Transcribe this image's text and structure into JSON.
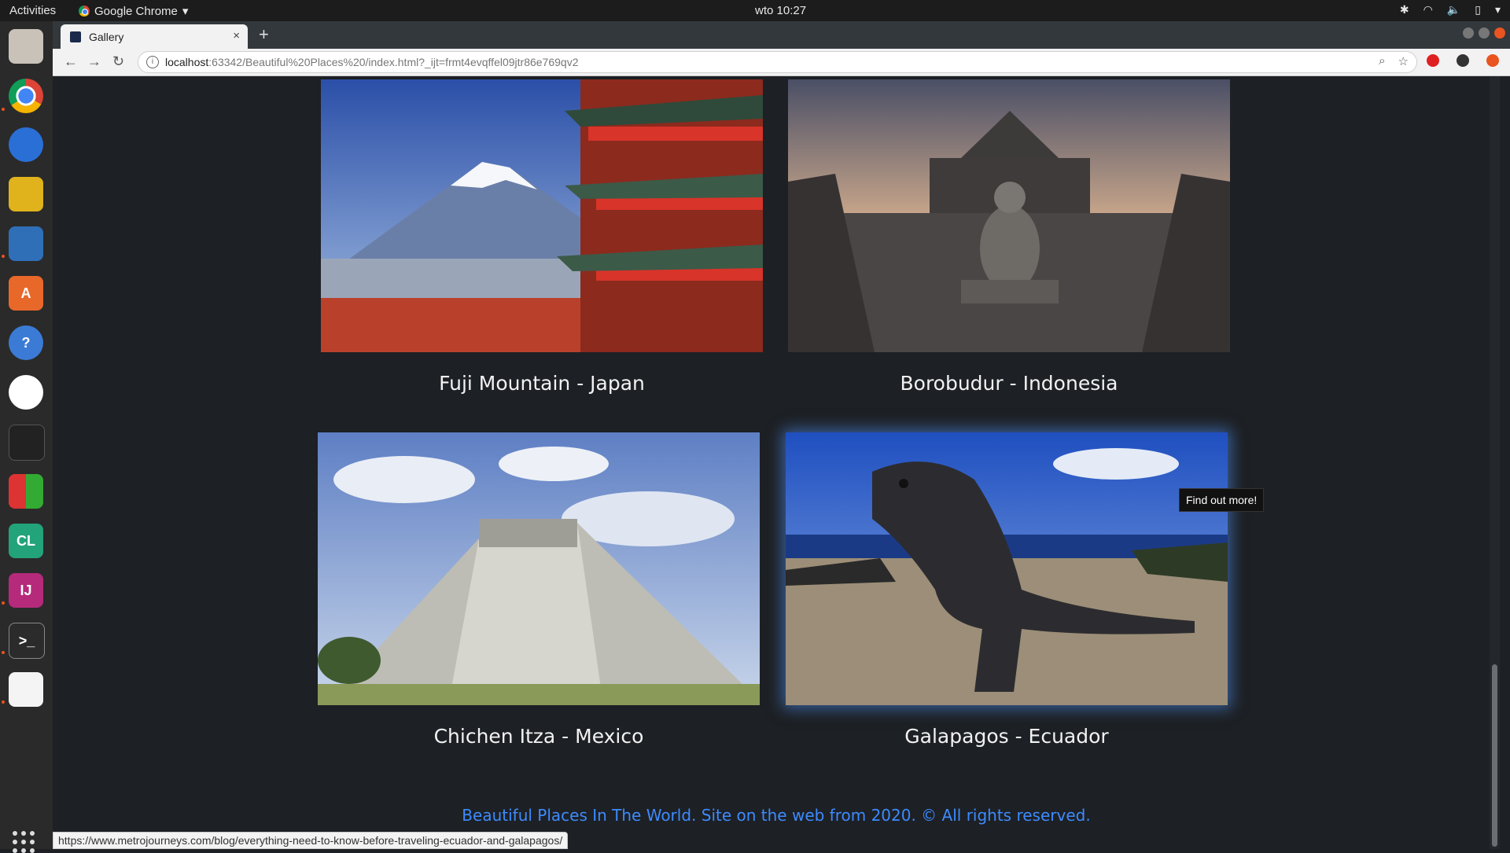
{
  "topbar": {
    "activities": "Activities",
    "app_name": "Google Chrome",
    "app_menu_icon": "chevron-down-icon",
    "clock": "wto 10:27"
  },
  "browser": {
    "tab_title": "Gallery",
    "tab_close": "×",
    "new_tab": "+",
    "url_host": "localhost",
    "url_path": ":63342/Beautiful%20Places%20/index.html?_ijt=frmt4evqffel09jtr86e769qv2"
  },
  "gallery": {
    "items": [
      {
        "caption": "Fuji Mountain - Japan",
        "image": "fuji-pagoda-photo"
      },
      {
        "caption": "Borobudur - Indonesia",
        "image": "borobudur-temple-photo"
      },
      {
        "caption": "Chichen Itza - Mexico",
        "image": "chichen-itza-pyramid-photo"
      },
      {
        "caption": "Galapagos - Ecuador",
        "image": "galapagos-iguana-photo"
      }
    ],
    "tooltip": "Find out more!"
  },
  "footer": {
    "text": "Beautiful Places In The World. Site on the web from 2020. © All rights reserved."
  },
  "statusbar": {
    "link": "https://www.metrojourneys.com/blog/everything-need-to-know-before-traveling-ecuador-and-galapagos/"
  },
  "colors": {
    "page_bg": "#1d2024",
    "footer_text": "#3d8bff",
    "hover_glow": "#5096ff"
  }
}
